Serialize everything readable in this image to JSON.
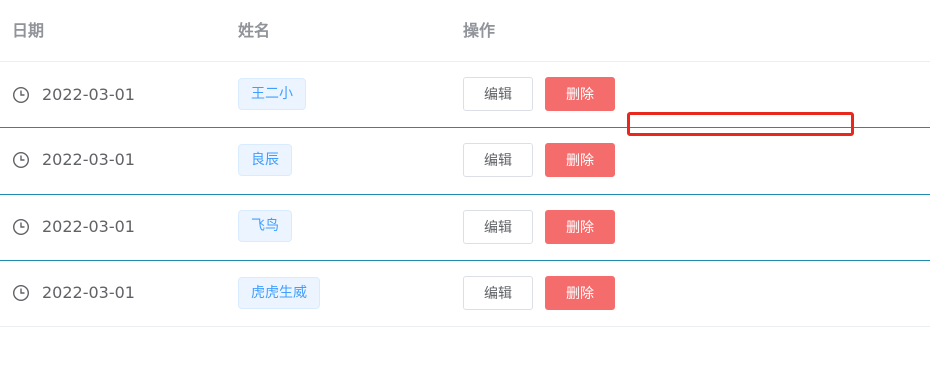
{
  "table": {
    "headers": {
      "date": "日期",
      "name": "姓名",
      "actions": "操作"
    },
    "rows": [
      {
        "date": "2022-03-01",
        "name": "王二小",
        "edit": "编辑",
        "delete": "删除"
      },
      {
        "date": "2022-03-01",
        "name": "良辰",
        "edit": "编辑",
        "delete": "删除"
      },
      {
        "date": "2022-03-01",
        "name": "飞鸟",
        "edit": "编辑",
        "delete": "删除"
      },
      {
        "date": "2022-03-01",
        "name": "虎虎生威",
        "edit": "编辑",
        "delete": "删除"
      }
    ]
  },
  "icons": {
    "date": "clock-icon"
  },
  "colors": {
    "header_text": "#909399",
    "body_text": "#606266",
    "tag_text": "#409eff",
    "tag_bg": "#ecf5ff",
    "danger": "#f56c6c",
    "row_divider": "#1f8bb0",
    "highlight": "#e8281f"
  }
}
